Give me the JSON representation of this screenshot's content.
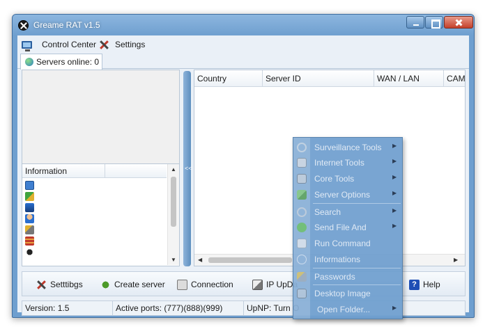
{
  "window": {
    "title": "Greame RAT v1.5"
  },
  "menu": {
    "control_center": "Control Center",
    "settings": "Settings"
  },
  "tab": {
    "label": "Servers online: 0"
  },
  "info_panel": {
    "header": "Information",
    "row_icons": [
      "monitor-icon",
      "users-icon",
      "desktop-icon",
      "user-icon",
      "key-icon",
      "firewall-icon",
      "gear-icon"
    ]
  },
  "splitter": {
    "arrows": "<<"
  },
  "server_grid": {
    "columns": [
      "Country",
      "Server ID",
      "WAN / LAN",
      "CAM"
    ]
  },
  "toolbar": {
    "settings": "Setttibgs",
    "create_server": "Create server",
    "connection": "Connection",
    "ip_update": "IP UpDa",
    "help": "Help"
  },
  "status": {
    "version": "Version: 1.5",
    "active_ports": "Active ports: (777)(888)(999)",
    "upnp": "UpNP: Turn O"
  },
  "context_menu": {
    "items": [
      {
        "label": "Surveillance Tools",
        "submenu": true,
        "icon": "fingerprint-icon"
      },
      {
        "label": "Internet Tools",
        "submenu": true,
        "icon": "printer-icon"
      },
      {
        "label": "Core Tools",
        "submenu": true,
        "icon": "tools-icon"
      },
      {
        "label": "Server Options",
        "submenu": true,
        "icon": "server-options-icon"
      },
      {
        "label": "Search",
        "submenu": true,
        "icon": "search-icon"
      },
      {
        "label": "Send File And",
        "submenu": true,
        "icon": "send-file-icon"
      },
      {
        "label": "Run Command",
        "submenu": false,
        "icon": "run-icon"
      },
      {
        "label": "Informations",
        "submenu": false,
        "icon": "info-icon"
      },
      {
        "label": "Passwords",
        "submenu": false,
        "icon": "key-icon"
      },
      {
        "label": "Desktop Image",
        "submenu": false,
        "icon": "desktop-image-icon"
      },
      {
        "label": "Open Folder...",
        "submenu": true,
        "icon": ""
      }
    ],
    "submenu_arrow": "▶"
  },
  "colors": {
    "frame": "#6f9fcf",
    "client": "#eaf0f7",
    "menu_bg": "#6f9fcf",
    "close_button": "#c4402a"
  }
}
